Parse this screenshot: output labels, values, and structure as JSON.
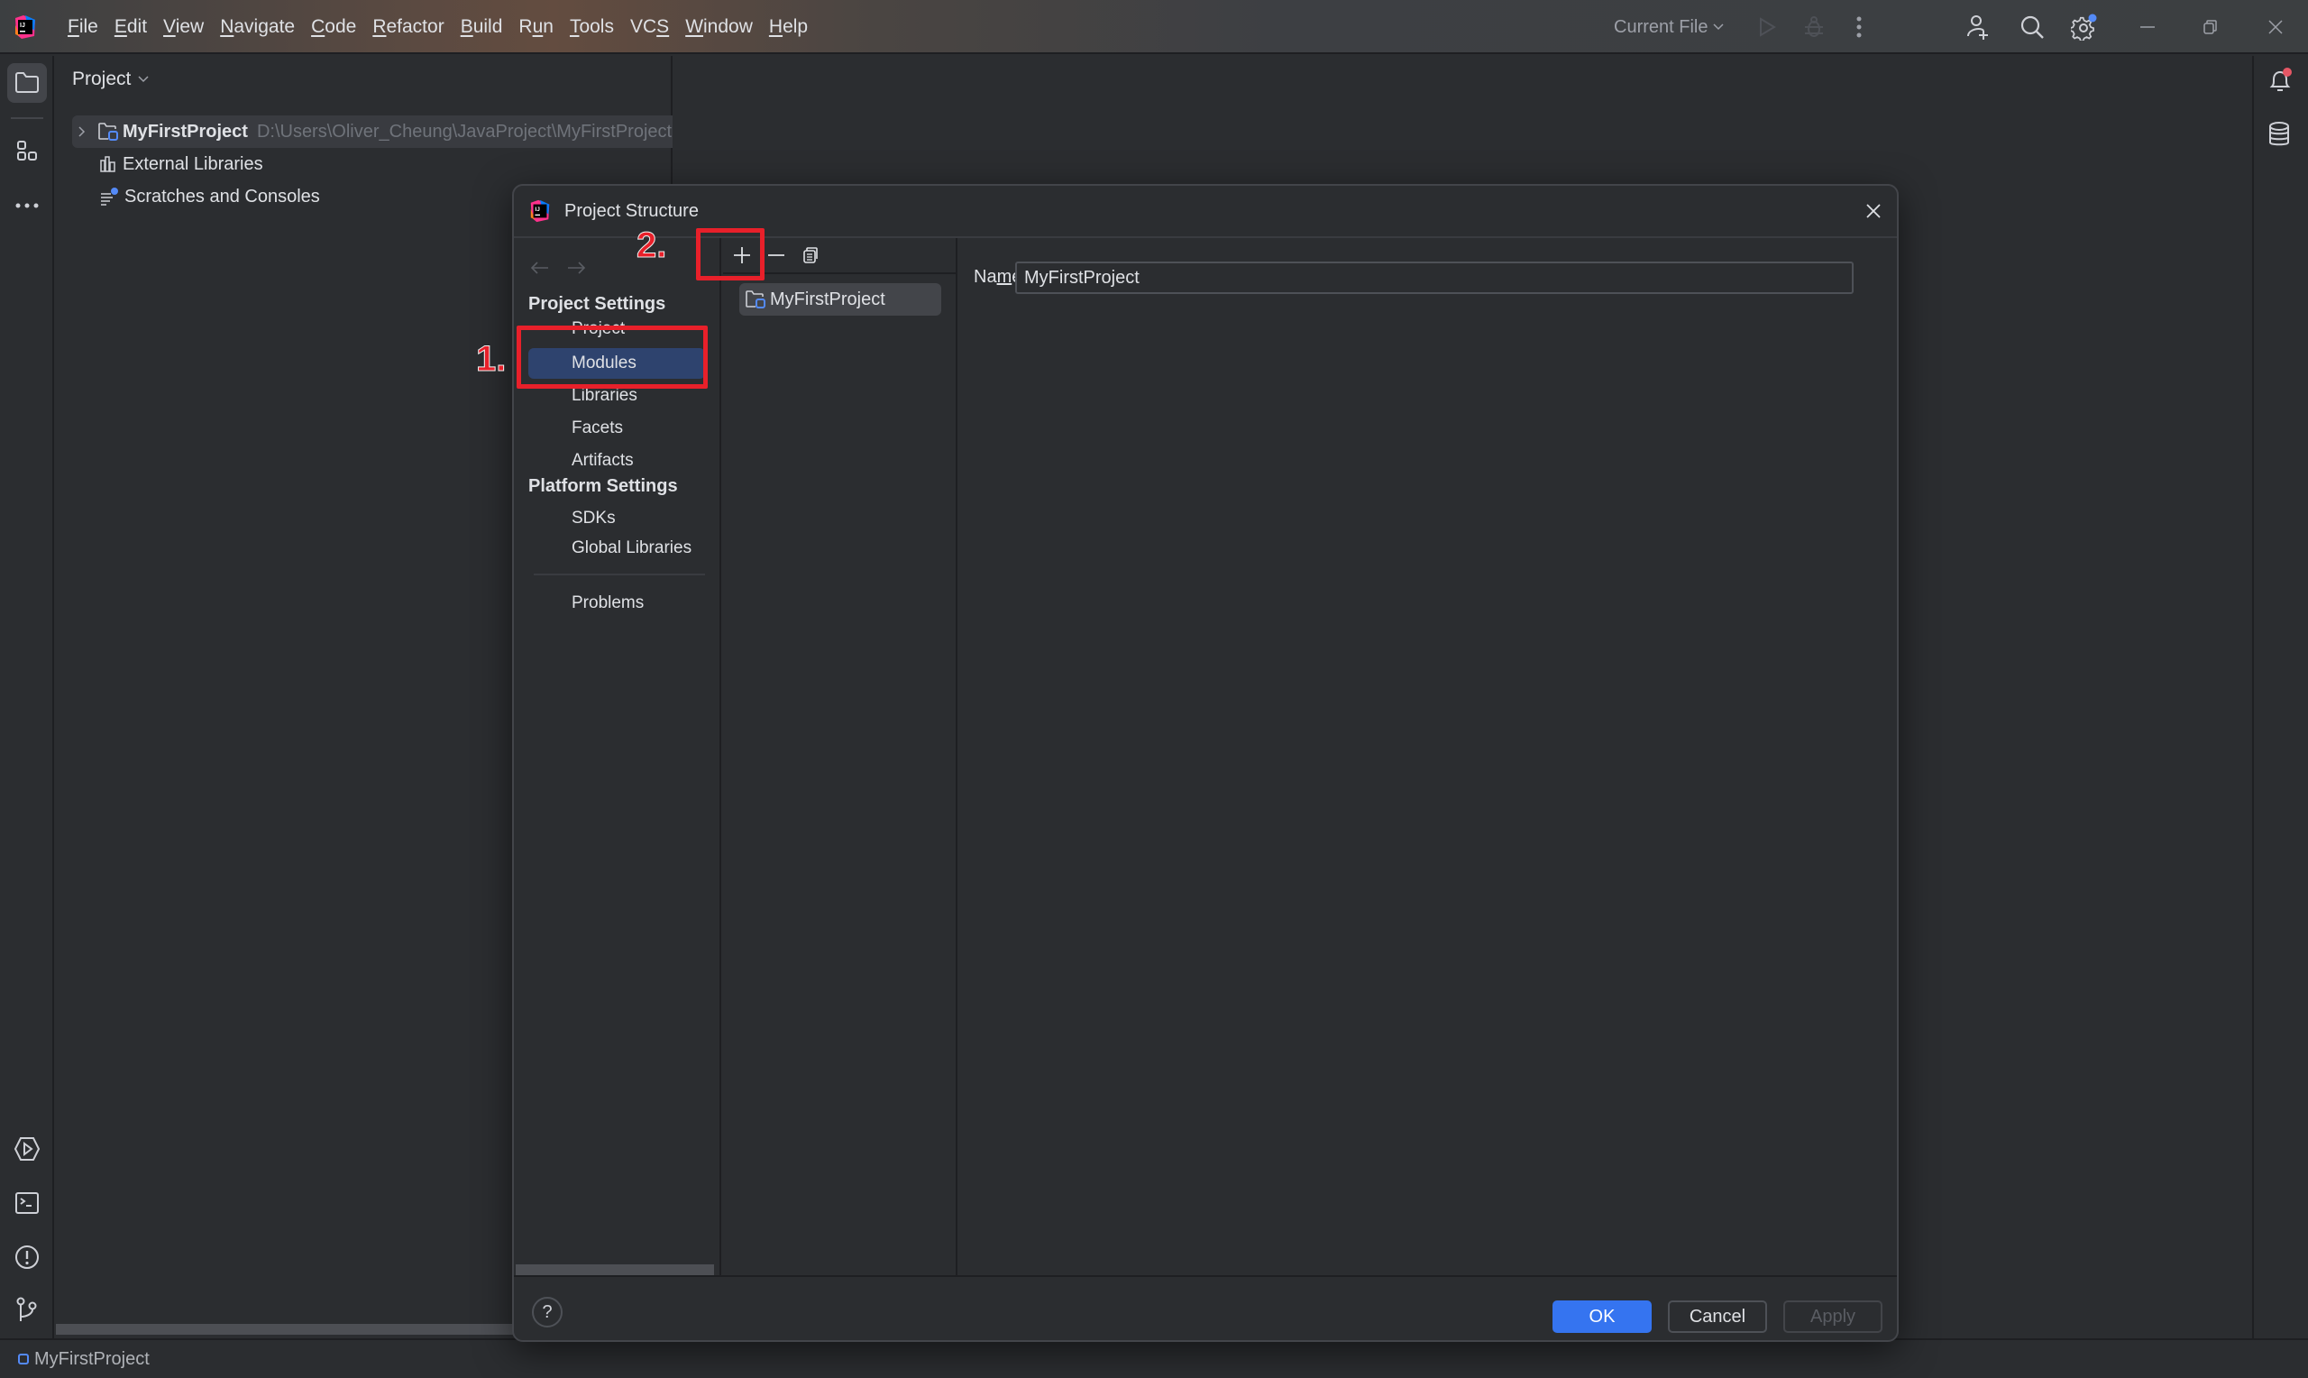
{
  "titlebar": {
    "menu": [
      {
        "label": "File",
        "mnemonic": "F",
        "rest": "ile"
      },
      {
        "label": "Edit",
        "mnemonic": "E",
        "rest": "dit"
      },
      {
        "label": "View",
        "mnemonic": "V",
        "rest": "iew"
      },
      {
        "label": "Navigate",
        "mnemonic": "N",
        "rest": "avigate"
      },
      {
        "label": "Code",
        "mnemonic": "C",
        "rest": "ode"
      },
      {
        "label": "Refactor",
        "mnemonic": "R",
        "rest": "efactor"
      },
      {
        "label": "Build",
        "mnemonic": "B",
        "rest": "uild"
      },
      {
        "label": "Run",
        "pre": "R",
        "mnemonic": "u",
        "rest": "n"
      },
      {
        "label": "Tools",
        "mnemonic": "T",
        "rest": "ools"
      },
      {
        "label": "VCS",
        "pre": "VC",
        "mnemonic": "S",
        "rest": ""
      },
      {
        "label": "Window",
        "mnemonic": "W",
        "rest": "indow"
      },
      {
        "label": "Help",
        "mnemonic": "H",
        "rest": "elp"
      }
    ],
    "run_config": "Current File",
    "icons": [
      "app-logo-icon",
      "run-icon",
      "debug-icon",
      "more-vertical-icon",
      "add-user-icon",
      "search-icon",
      "settings-icon",
      "minimize-icon",
      "restore-icon",
      "close-icon"
    ]
  },
  "left_strip": {
    "top_icons": [
      "project-folder-icon",
      "structure-icon",
      "more-horizontal-icon"
    ],
    "bottom_icons": [
      "services-run-icon",
      "terminal-icon",
      "problems-icon",
      "git-icon"
    ]
  },
  "right_strip": {
    "icons": [
      "notifications-icon",
      "database-icon"
    ]
  },
  "project_panel": {
    "title": "Project",
    "tree": [
      {
        "name": "MyFirstProject",
        "path": "D:\\Users\\Oliver_Cheung\\JavaProject\\MyFirstProject",
        "icon": "module-folder-icon",
        "expandable": true,
        "selected": true
      },
      {
        "name": "External Libraries",
        "icon": "library-icon"
      },
      {
        "name": "Scratches and Consoles",
        "icon": "scratches-icon"
      }
    ]
  },
  "status_bar": {
    "project": "MyFirstProject"
  },
  "dialog": {
    "title": "Project Structure",
    "sections": [
      {
        "header": "Project Settings",
        "items": [
          "Project",
          "Modules",
          "Libraries",
          "Facets",
          "Artifacts"
        ]
      },
      {
        "header": "Platform Settings",
        "items": [
          "SDKs",
          "Global Libraries"
        ]
      }
    ],
    "extra_items": [
      "Problems"
    ],
    "selected_item": "Modules",
    "module_toolbar": {
      "add_tooltip": "Add",
      "remove_tooltip": "Remove",
      "copy_tooltip": "Copy"
    },
    "modules": [
      "MyFirstProject"
    ],
    "name_label": "Name:",
    "name_label_pre": "Na",
    "name_label_mnemonic": "m",
    "name_label_post": "e:",
    "name_value": "MyFirstProject",
    "buttons": {
      "ok": "OK",
      "cancel": "Cancel",
      "apply": "Apply",
      "help": "?"
    }
  },
  "annotations": [
    {
      "label": "1.",
      "target": "Modules"
    },
    {
      "label": "2.",
      "target": "Add module button"
    }
  ],
  "colors": {
    "accent": "#3574f0",
    "selection": "#2e436e",
    "annotation": "#e8202a",
    "notification_dot": "#e55765",
    "background": "#2b2d30"
  }
}
